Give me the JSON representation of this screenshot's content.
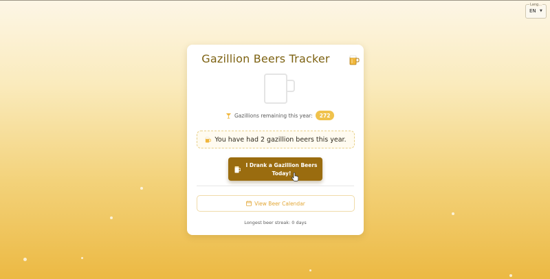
{
  "language": {
    "label": "Lang...",
    "selected": "EN"
  },
  "card": {
    "title": "Gazillion Beers Tracker",
    "remaining_label": "Gazillions remaining this year:",
    "remaining_count": "272",
    "had_message": "You have had 2 gazillion beers this year.",
    "drank_button": "I Drank a Gazillion Beers Today!",
    "calendar_button": "View Beer Calendar",
    "streak_text": "Longest beer streak: 0 days"
  },
  "icons": {
    "corner": "beer-mug-icon",
    "mug": "empty-mug-icon",
    "remaining": "cocktail-glass-icon",
    "had": "beer-icon",
    "drank": "beer-glass-icon",
    "calendar": "calendar-icon"
  },
  "colors": {
    "title": "#7d6212",
    "accent": "#f0c24c",
    "primary_button": "#9a6c0f",
    "calendar_text": "#e2a737"
  }
}
